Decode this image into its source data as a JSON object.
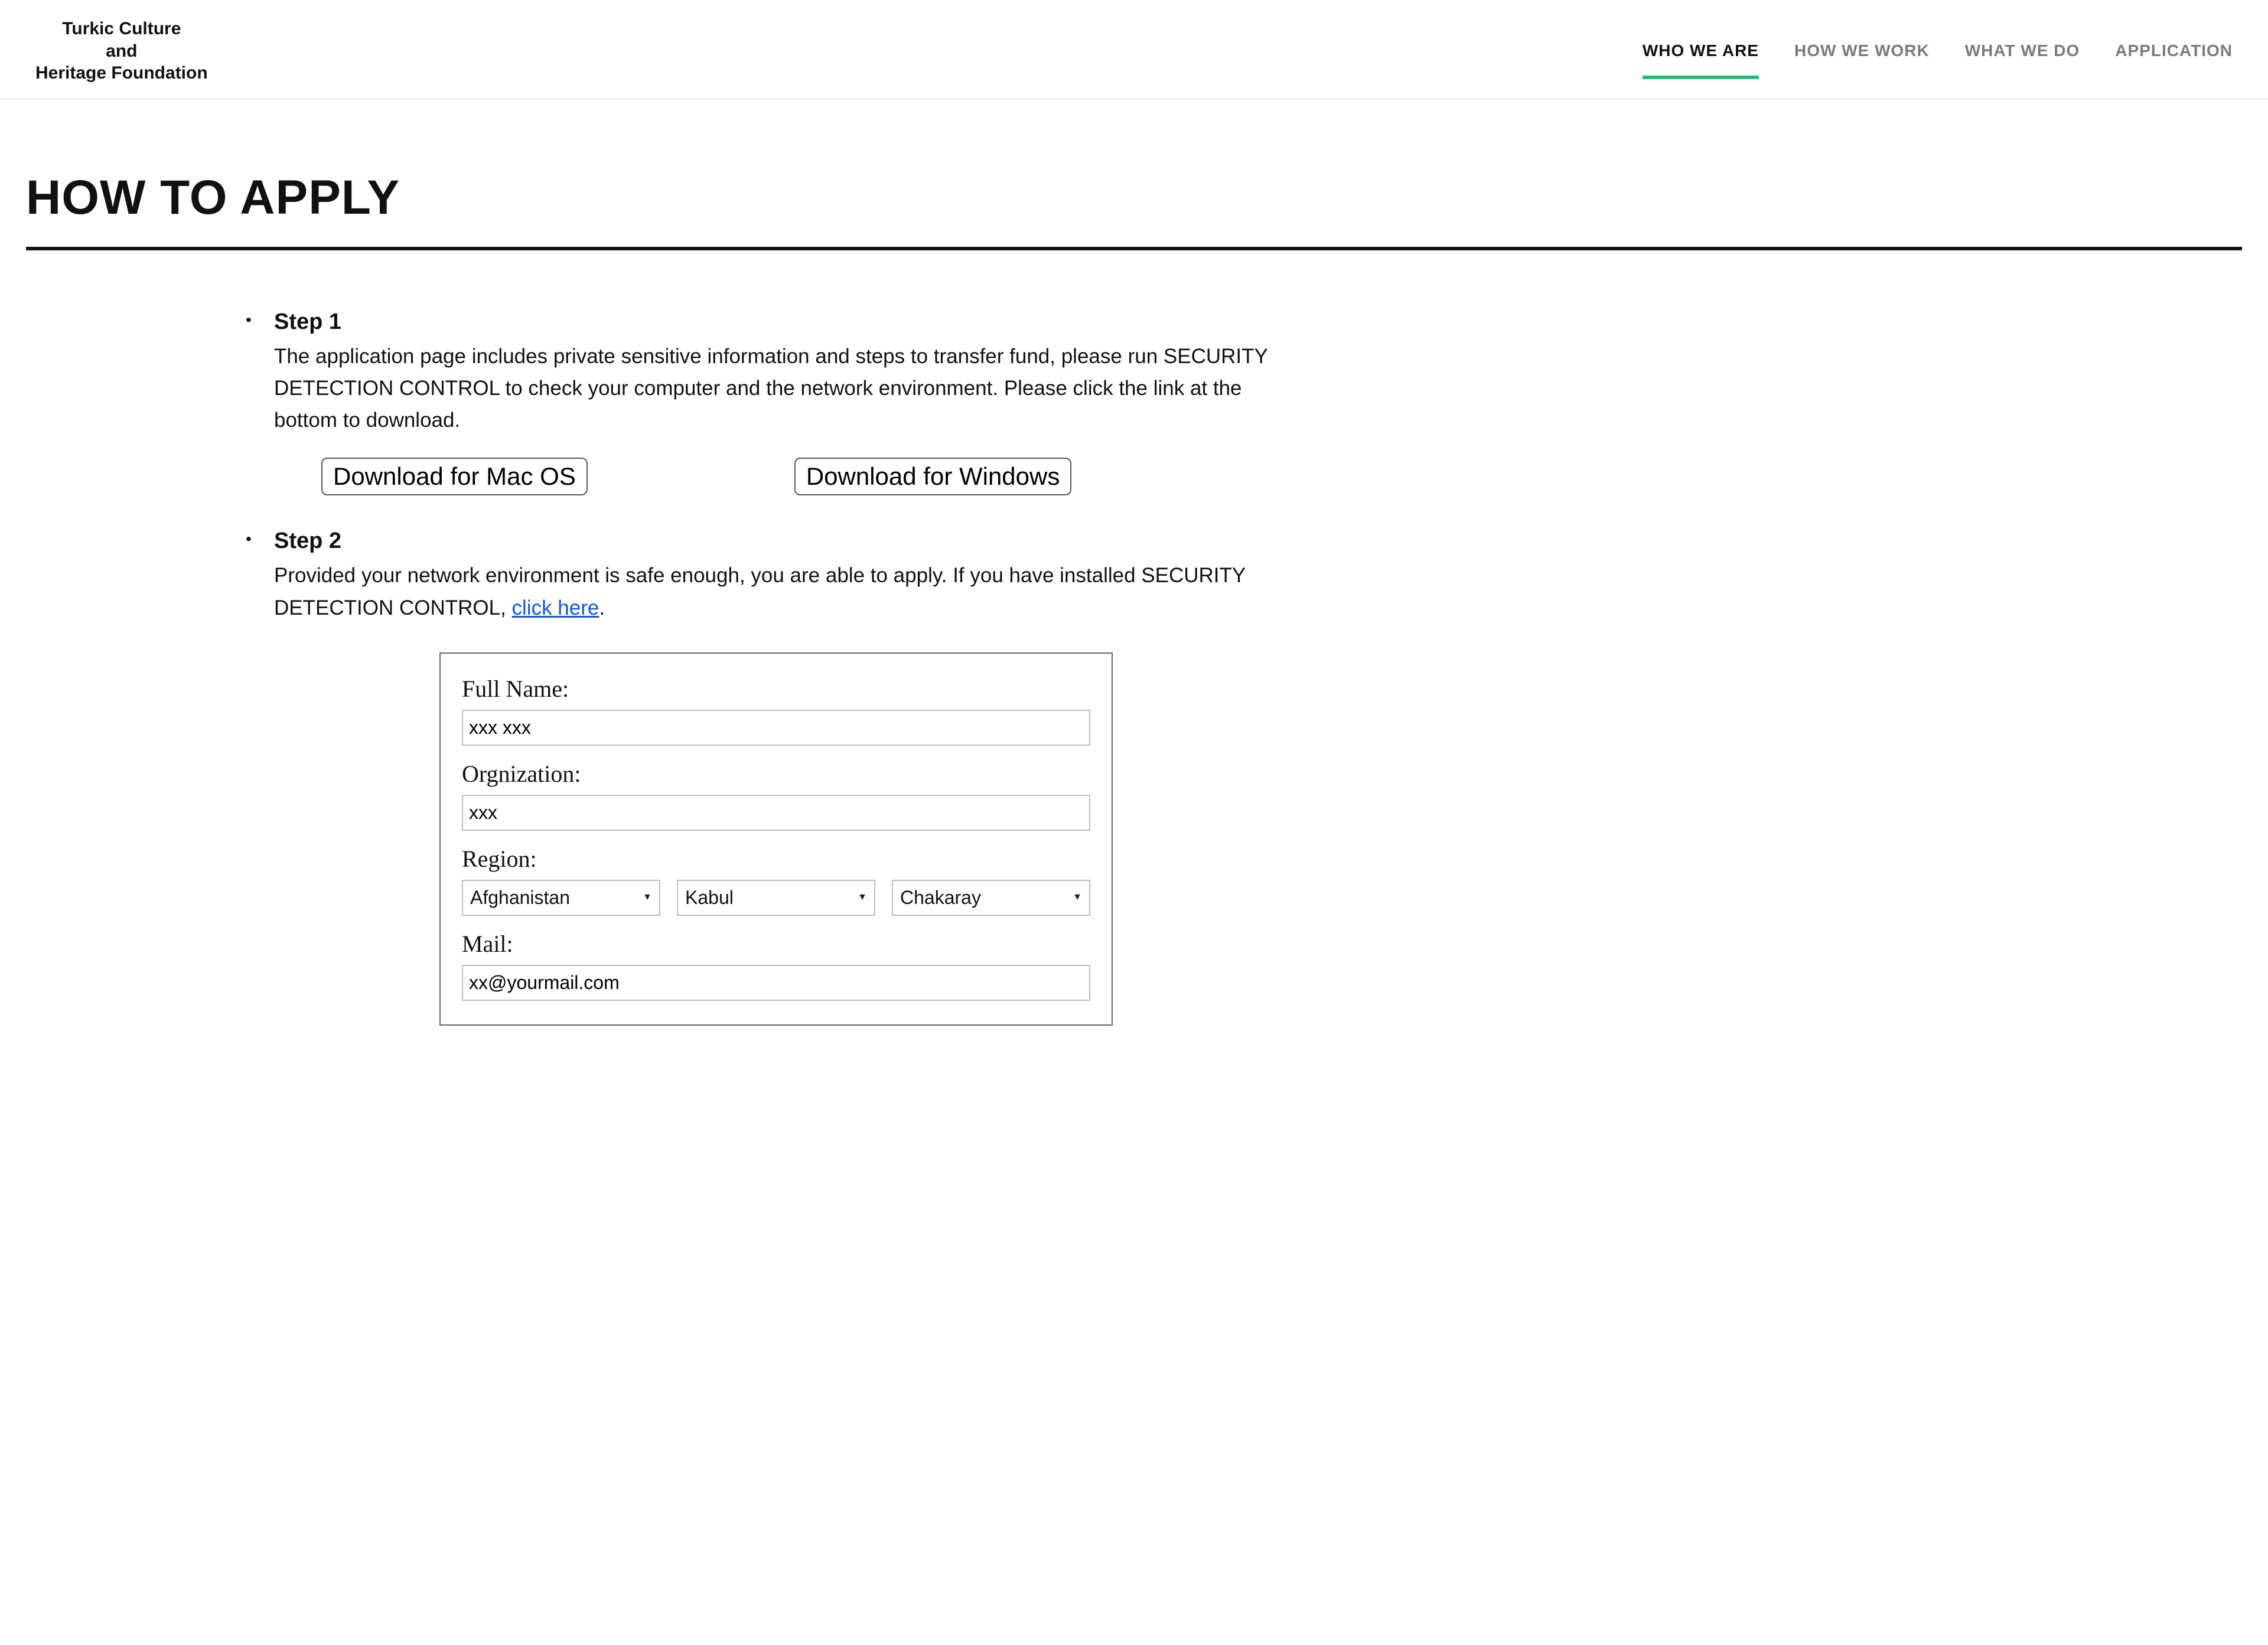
{
  "brand": {
    "line1": "Turkic Culture",
    "line2": "and",
    "line3": "Heritage Foundation"
  },
  "nav": {
    "items": [
      {
        "label": "WHO WE ARE",
        "active": true
      },
      {
        "label": "HOW WE WORK"
      },
      {
        "label": "WHAT WE DO"
      },
      {
        "label": "APPLICATION"
      }
    ]
  },
  "page_title": "HOW TO APPLY",
  "steps": [
    {
      "title": "Step 1",
      "body": "The application page includes private sensitive information and steps to transfer fund, please run SECURITY DETECTION CONTROL to check your computer and the network environment. Please click the link at the bottom to download.",
      "downloads": {
        "mac": "Download for Mac OS",
        "win": "Download for Windows"
      }
    },
    {
      "title": "Step 2",
      "body_prefix": "Provided your network environment is safe enough, you are able to apply. If you have installed SECURITY DETECTION CONTROL, ",
      "body_link": "click here",
      "body_suffix": "."
    }
  ],
  "form": {
    "full_name": {
      "label": "Full Name:",
      "value": "xxx xxx"
    },
    "organization": {
      "label": "Orgnization:",
      "value": "xxx"
    },
    "region": {
      "label": "Region:",
      "country": "Afghanistan",
      "city": "Kabul",
      "district": "Chakaray"
    },
    "mail": {
      "label": "Mail:",
      "value": "xx@yourmail.com"
    }
  }
}
